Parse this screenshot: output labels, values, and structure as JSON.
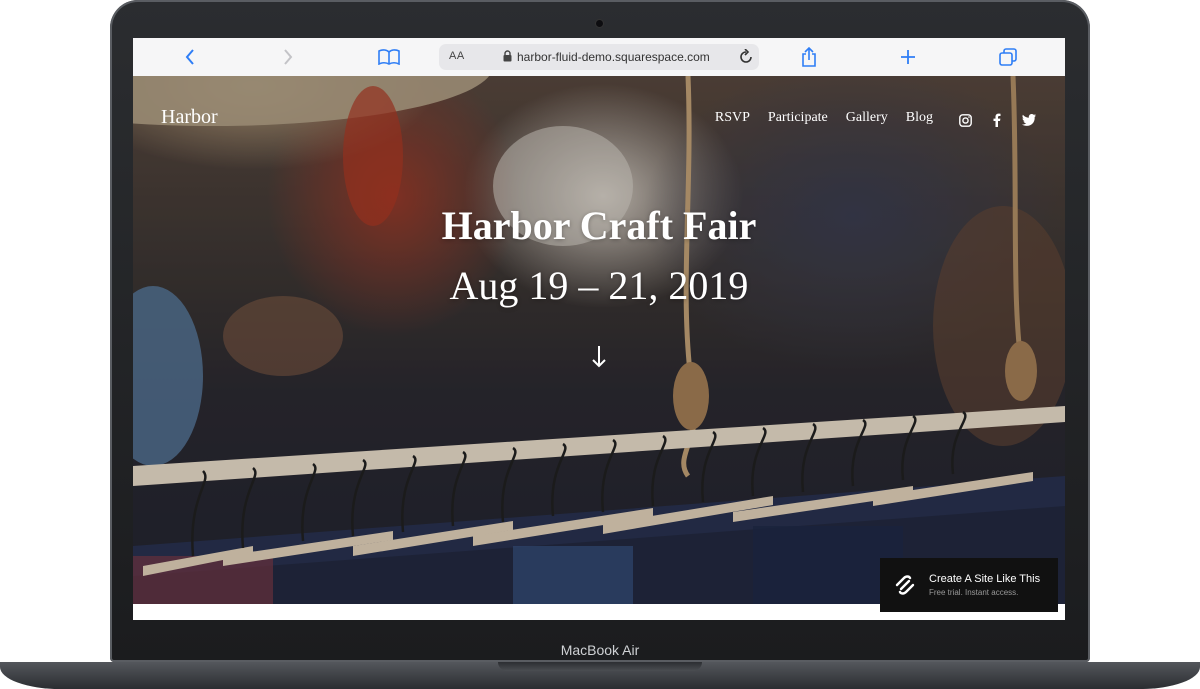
{
  "browser": {
    "url_aa": "AA",
    "url": "harbor-fluid-demo.squarespace.com"
  },
  "site": {
    "logo": "Harbor",
    "nav": [
      "RSVP",
      "Participate",
      "Gallery",
      "Blog"
    ],
    "social_icons": [
      "instagram-icon",
      "facebook-icon",
      "twitter-icon"
    ]
  },
  "hero": {
    "title": "Harbor Craft Fair",
    "date": "Aug 19 – 21, 2019"
  },
  "promo": {
    "title": "Create A Site Like This",
    "subtitle": "Free trial. Instant access."
  },
  "device": {
    "label": "MacBook Air"
  },
  "colors": {
    "accent": "#2f7ef6",
    "promo_bg": "#111111"
  }
}
